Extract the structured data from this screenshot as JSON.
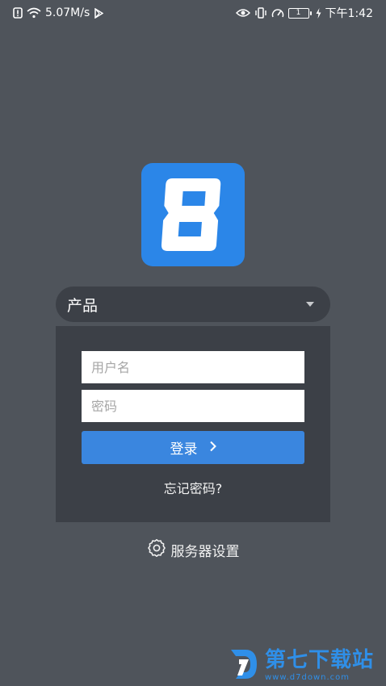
{
  "status_bar": {
    "network_speed": "5.07M/s",
    "battery_level": "1",
    "time": "下午1:42",
    "icons": [
      "alert-icon",
      "wifi-icon",
      "play-store-icon",
      "eye-icon",
      "vibrate-icon",
      "speed-icon",
      "battery-icon",
      "charging-icon"
    ]
  },
  "logo": {
    "glyph": "8",
    "color": "#2b86e8"
  },
  "product_select": {
    "selected": "产品"
  },
  "login_form": {
    "username_placeholder": "用户名",
    "password_placeholder": "密码",
    "login_label": "登录",
    "forgot_label": "忘记密码?"
  },
  "server_settings": {
    "label": "服务器设置"
  },
  "watermark": {
    "title": "第七下载站",
    "url": "www.d7down.com"
  },
  "colors": {
    "background": "#4f545b",
    "panel": "#3c4047",
    "accent": "#3a86df"
  }
}
